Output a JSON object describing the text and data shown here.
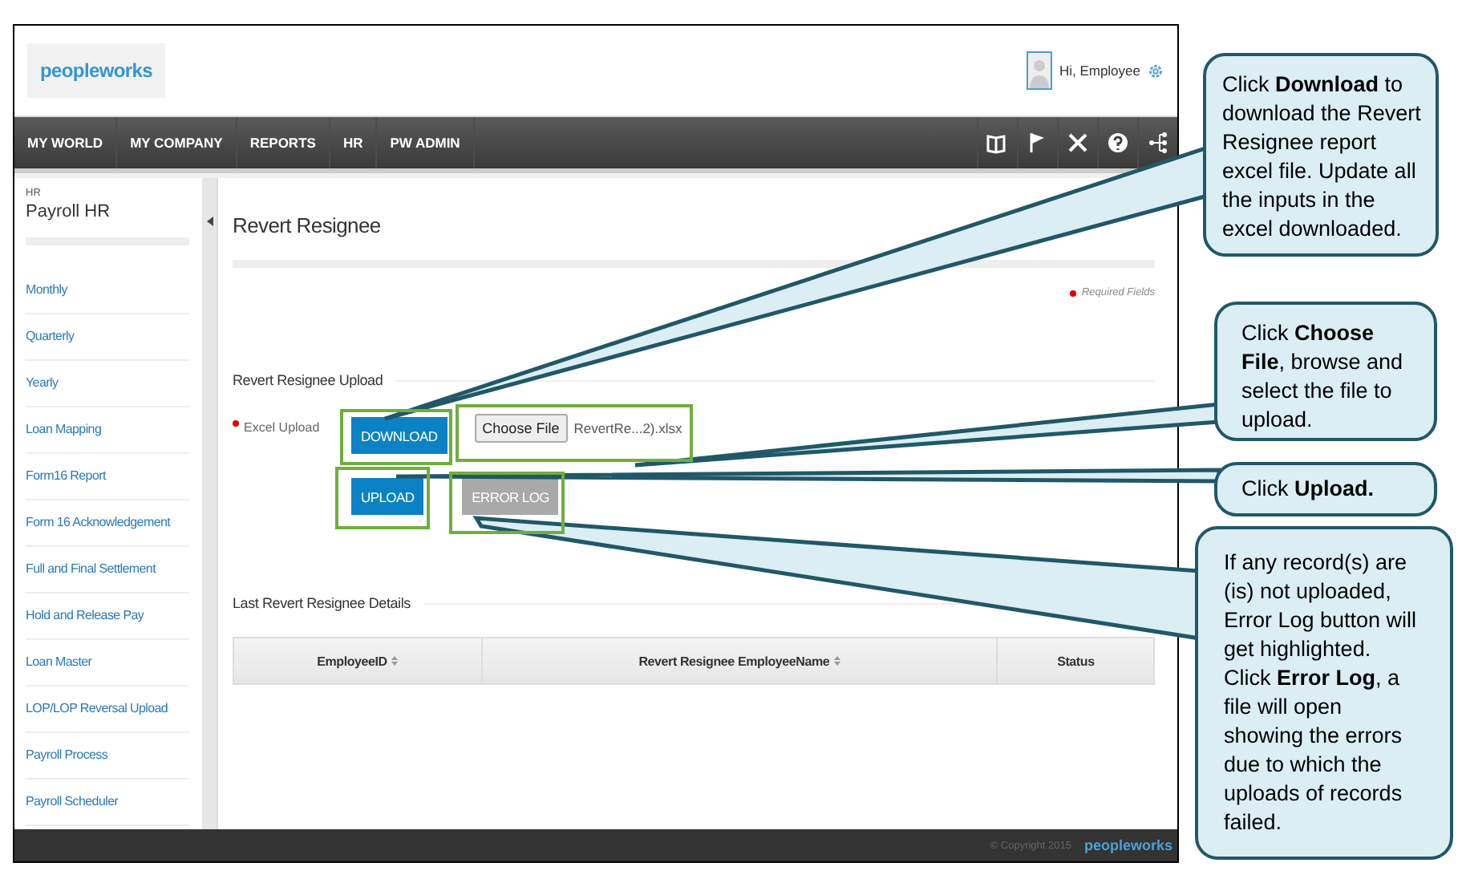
{
  "header": {
    "logo": "peopleworks",
    "greeting": "Hi, Employee"
  },
  "nav": {
    "items": [
      {
        "label": "MY WORLD"
      },
      {
        "label": "MY COMPANY"
      },
      {
        "label": "REPORTS"
      },
      {
        "label": "HR"
      },
      {
        "label": "PW ADMIN"
      }
    ]
  },
  "sidebar": {
    "section": "HR",
    "title": "Payroll HR",
    "items": [
      {
        "label": "Monthly"
      },
      {
        "label": "Quarterly"
      },
      {
        "label": "Yearly"
      },
      {
        "label": "Loan Mapping"
      },
      {
        "label": "Form16 Report"
      },
      {
        "label": "Form 16 Acknowledgement"
      },
      {
        "label": "Full and Final Settlement"
      },
      {
        "label": "Hold and Release Pay"
      },
      {
        "label": "Loan Master"
      },
      {
        "label": "LOP/LOP Reversal Upload"
      },
      {
        "label": "Payroll Process"
      },
      {
        "label": "Payroll Scheduler"
      }
    ]
  },
  "page": {
    "title": "Revert Resignee",
    "required_note": "Required Fields",
    "upload_section": "Revert Resignee Upload",
    "field_label": "Excel Upload",
    "download_button": "DOWNLOAD",
    "choose_file_button": "Choose File",
    "file_name": "RevertRe...2).xlsx",
    "upload_button": "UPLOAD",
    "error_log_button": {
      "label": "ERROR LOG",
      "disabled": true
    },
    "details_section": "Last Revert Resignee Details",
    "table": {
      "columns": [
        {
          "label": "EmployeeID",
          "sortable": true
        },
        {
          "label": "Revert Resignee EmployeeName",
          "sortable": true
        },
        {
          "label": "Status",
          "sortable": false
        }
      ]
    }
  },
  "footer": {
    "copyright": "© Copyright 2015",
    "logo": "peopleworks"
  },
  "callouts": [
    {
      "text": "Click **Download** to download the Revert Resignee report excel file. Update all the inputs in the excel downloaded."
    },
    {
      "text": "Click **Choose File**, browse and select the file to upload."
    },
    {
      "text": "Click **Upload.**"
    },
    {
      "text": "If any record(s) are (is) not uploaded, Error Log button will get highlighted. Click **Error Log**, a file will open showing the errors due to which the uploads of records failed."
    }
  ]
}
